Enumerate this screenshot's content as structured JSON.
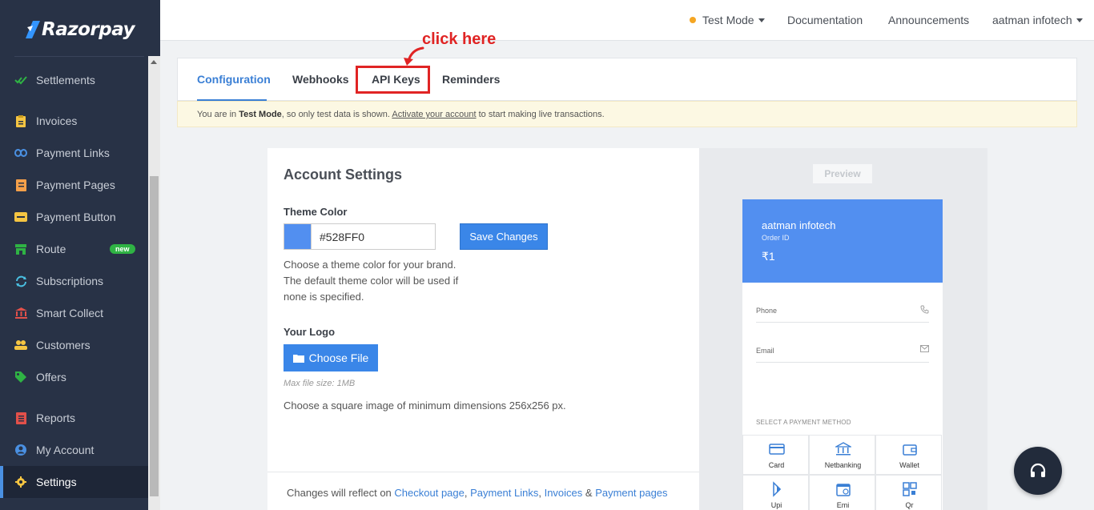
{
  "brand": {
    "name": "Razorpay"
  },
  "sidebar": {
    "items": [
      {
        "key": "settlements",
        "label": "Settlements",
        "icon": "double-check-icon",
        "color": "#2fb344"
      },
      {
        "key": "invoices",
        "label": "Invoices",
        "icon": "invoice-icon",
        "color": "#f5c542"
      },
      {
        "key": "payment-links",
        "label": "Payment Links",
        "icon": "link-icon",
        "color": "#4a90e2"
      },
      {
        "key": "payment-pages",
        "label": "Payment Pages",
        "icon": "page-icon",
        "color": "#f5a04a"
      },
      {
        "key": "payment-button",
        "label": "Payment Button",
        "icon": "pay-button-icon",
        "color": "#f5c542"
      },
      {
        "key": "route",
        "label": "Route",
        "icon": "store-icon",
        "color": "#2fb344",
        "badge": "new"
      },
      {
        "key": "subscriptions",
        "label": "Subscriptions",
        "icon": "refresh-icon",
        "color": "#4ac0e2"
      },
      {
        "key": "smart-collect",
        "label": "Smart Collect",
        "icon": "bank-icon",
        "color": "#e2504a"
      },
      {
        "key": "customers",
        "label": "Customers",
        "icon": "users-icon",
        "color": "#f5c542"
      },
      {
        "key": "offers",
        "label": "Offers",
        "icon": "tag-icon",
        "color": "#2fb344"
      },
      {
        "key": "reports",
        "label": "Reports",
        "icon": "report-icon",
        "color": "#e2504a"
      },
      {
        "key": "my-account",
        "label": "My Account",
        "icon": "user-circle-icon",
        "color": "#4a90e2"
      },
      {
        "key": "settings",
        "label": "Settings",
        "icon": "gear-icon",
        "color": "#f5c542",
        "active": true
      }
    ]
  },
  "topbar": {
    "mode": "Test Mode",
    "documentation": "Documentation",
    "announcements": "Announcements",
    "account": "aatman infotech"
  },
  "annotation": {
    "text": "click here"
  },
  "tabs": [
    {
      "label": "Configuration",
      "active": true
    },
    {
      "label": "Webhooks"
    },
    {
      "label": "API Keys"
    },
    {
      "label": "Reminders"
    }
  ],
  "banner": {
    "prefix": "You are in ",
    "mode": "Test Mode",
    "middle": ", so only test data is shown. ",
    "link": "Activate your account",
    "suffix": " to start making live transactions."
  },
  "settings": {
    "title": "Account Settings",
    "theme_label": "Theme Color",
    "theme_value": "#528FF0",
    "save_label": "Save Changes",
    "theme_help_1": "Choose a theme color for your brand.",
    "theme_help_2": "The default theme color will be used if",
    "theme_help_3": "none is specified.",
    "logo_label": "Your Logo",
    "choose_file": "Choose File",
    "max_size": "Max file size: 1MB",
    "logo_help": "Choose a square image of minimum dimensions 256x256 px.",
    "footer_prefix": "Changes will reflect on ",
    "footer_link_1": "Checkout page",
    "footer_sep_1": ", ",
    "footer_link_2": "Payment Links",
    "footer_sep_2": ", ",
    "footer_link_3": "Invoices",
    "footer_sep_3": " & ",
    "footer_link_4": "Payment pages"
  },
  "preview": {
    "label": "Preview",
    "merchant": "aatman infotech",
    "order_label": "Order ID",
    "amount": "₹1",
    "phone_label": "Phone",
    "email_label": "Email",
    "method_title": "SELECT A PAYMENT METHOD",
    "methods": [
      "Card",
      "Netbanking",
      "Wallet",
      "Upi",
      "Emi",
      "Qr"
    ]
  },
  "colors": {
    "accent": "#3a7fd5",
    "sidebar_bg": "#283246",
    "annotation": "#e02424"
  }
}
